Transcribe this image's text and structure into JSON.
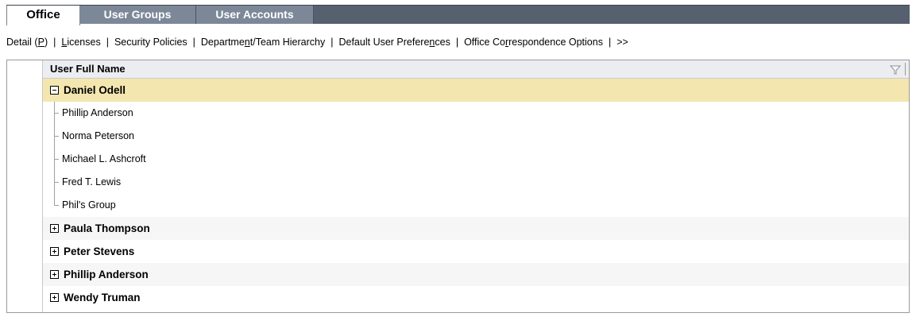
{
  "tabs": [
    {
      "label": "Office",
      "active": true
    },
    {
      "label": "User Groups",
      "active": false
    },
    {
      "label": "User Accounts",
      "active": false
    }
  ],
  "command_bar": {
    "detail": {
      "pre": "Detail (",
      "key": "P",
      "post": ")"
    },
    "licenses": {
      "pre": "",
      "key": "L",
      "post": "icenses"
    },
    "security_policies": "Security Policies",
    "hierarchy": {
      "pre": "Departme",
      "key": "n",
      "post": "t/Team Hierarchy"
    },
    "default_prefs": {
      "pre": "Default User Prefere",
      "key": "n",
      "post": "ces"
    },
    "correspondence": {
      "pre": "Office Co",
      "key": "r",
      "post": "respondence Options"
    },
    "more": ">>",
    "separator": "|"
  },
  "grid": {
    "column_header": "User Full Name",
    "filter_icon": "filter-icon",
    "rows": [
      {
        "label": "Daniel Odell",
        "expanded": true,
        "selected": true,
        "children": [
          "Phillip Anderson",
          "Norma Peterson",
          "Michael L. Ashcroft",
          "Fred T. Lewis",
          "Phil's Group"
        ]
      },
      {
        "label": "Paula Thompson",
        "expanded": false
      },
      {
        "label": "Peter Stevens",
        "expanded": false
      },
      {
        "label": "Phillip Anderson",
        "expanded": false
      },
      {
        "label": "Wendy Truman",
        "expanded": false
      }
    ]
  },
  "colors": {
    "tabstrip": "#56606e",
    "inactive_tab": "#7c8898",
    "selected_row": "#f3e6af",
    "header": "#ecedf0"
  }
}
